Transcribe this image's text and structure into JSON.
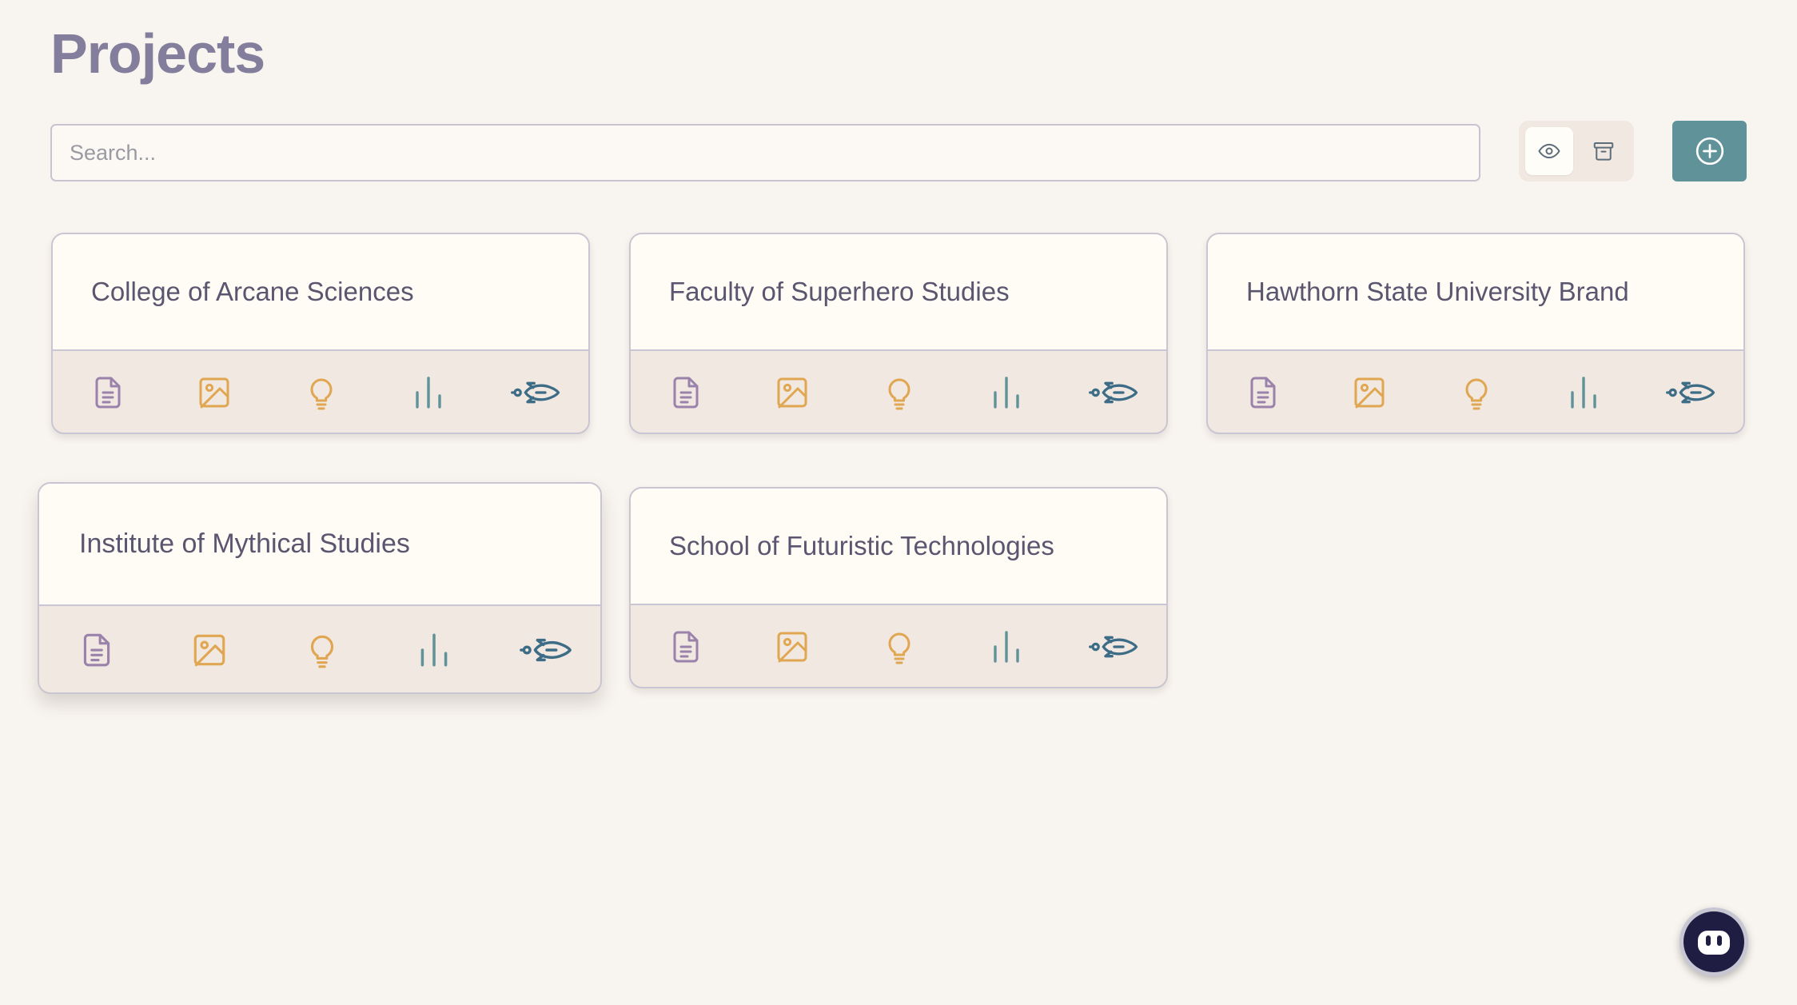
{
  "page": {
    "title": "Projects"
  },
  "search": {
    "placeholder": "Search..."
  },
  "toolbar": {
    "view_active_icon": "eye-icon",
    "view_archived_icon": "archive-icon",
    "add_icon": "plus-circle-icon"
  },
  "colors": {
    "document": "#9a82ab",
    "image": "#e0a651",
    "idea": "#e0a651",
    "chart": "#5f9399",
    "launch": "#3d6c86",
    "accent": "#5f9399",
    "title": "#837e9b"
  },
  "card_actions": [
    "document-icon",
    "image-icon",
    "lightbulb-icon",
    "bar-chart-icon",
    "rocket-icon"
  ],
  "projects": [
    {
      "name": "College of Arcane Sciences"
    },
    {
      "name": "Faculty of Superhero Studies"
    },
    {
      "name": "Hawthorn State University Brand"
    },
    {
      "name": "Institute of Mythical Studies"
    },
    {
      "name": "School of Futuristic Technologies"
    }
  ],
  "assistant": {
    "icon": "robot-icon"
  }
}
